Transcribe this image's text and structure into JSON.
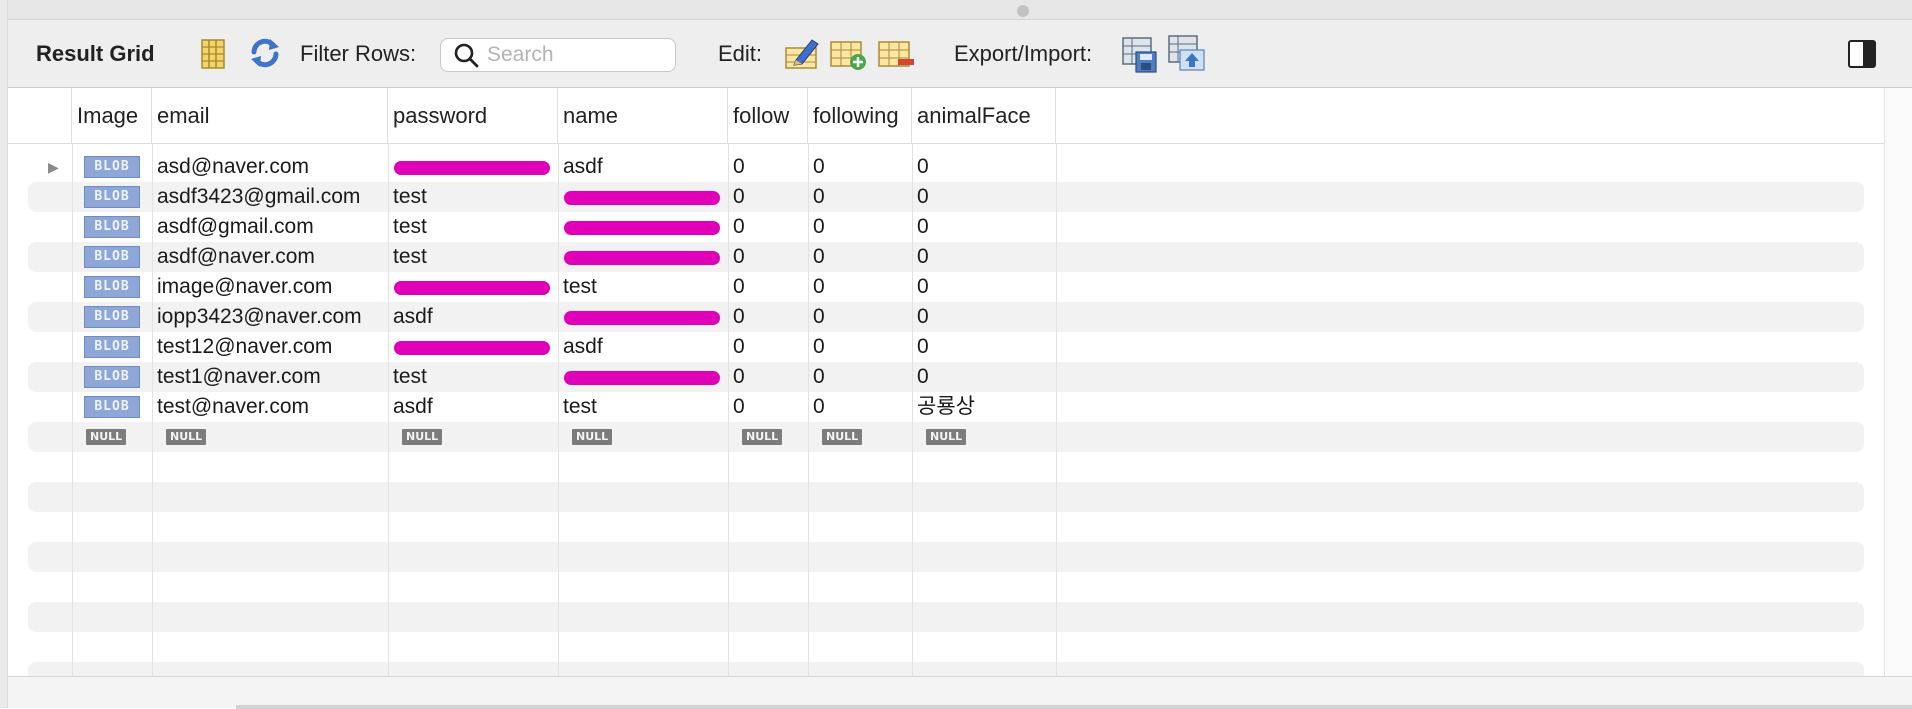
{
  "toolbar": {
    "title": "Result Grid",
    "filter_label": "Filter Rows:",
    "search_placeholder": "Search",
    "search_value": "",
    "edit_label": "Edit:",
    "export_label": "Export/Import:"
  },
  "icons": {
    "result_grid": "grid-columns-icon",
    "refresh": "refresh-icon",
    "search": "search-icon",
    "edit_row": "edit-row-icon",
    "add_row": "add-row-icon",
    "delete_row": "delete-row-icon",
    "export": "export-icon",
    "import": "import-icon",
    "panel_toggle": "sidebar-toggle-icon"
  },
  "colors": {
    "blob_badge": "#8fa7d6",
    "null_badge": "#7c7c7c",
    "redaction": "#e000b8"
  },
  "columns": [
    "Image",
    "email",
    "password",
    "name",
    "follow",
    "following",
    "animalFace"
  ],
  "rows": [
    {
      "image": "BLOB",
      "email": "asd@naver.com",
      "password": "",
      "name": "asdf",
      "follow": "0",
      "following": "0",
      "animalFace": "0"
    },
    {
      "image": "BLOB",
      "email": "asdf3423@gmail.com",
      "password": "test",
      "name": "",
      "follow": "0",
      "following": "0",
      "animalFace": "0"
    },
    {
      "image": "BLOB",
      "email": "asdf@gmail.com",
      "password": "test",
      "name": "",
      "follow": "0",
      "following": "0",
      "animalFace": "0"
    },
    {
      "image": "BLOB",
      "email": "asdf@naver.com",
      "password": "test",
      "name": "",
      "follow": "0",
      "following": "0",
      "animalFace": "0"
    },
    {
      "image": "BLOB",
      "email": "image@naver.com",
      "password": "",
      "name": "test",
      "follow": "0",
      "following": "0",
      "animalFace": "0"
    },
    {
      "image": "BLOB",
      "email": "iopp3423@naver.com",
      "password": "asdf",
      "name": "",
      "follow": "0",
      "following": "0",
      "animalFace": "0"
    },
    {
      "image": "BLOB",
      "email": "test12@naver.com",
      "password": "",
      "name": "asdf",
      "follow": "0",
      "following": "0",
      "animalFace": "0"
    },
    {
      "image": "BLOB",
      "email": "test1@naver.com",
      "password": "test",
      "name": "",
      "follow": "0",
      "following": "0",
      "animalFace": "0"
    },
    {
      "image": "BLOB",
      "email": "test@naver.com",
      "password": "asdf",
      "name": "test",
      "follow": "0",
      "following": "0",
      "animalFace": "공룡상"
    }
  ],
  "new_row": {
    "null_label": "NULL"
  }
}
